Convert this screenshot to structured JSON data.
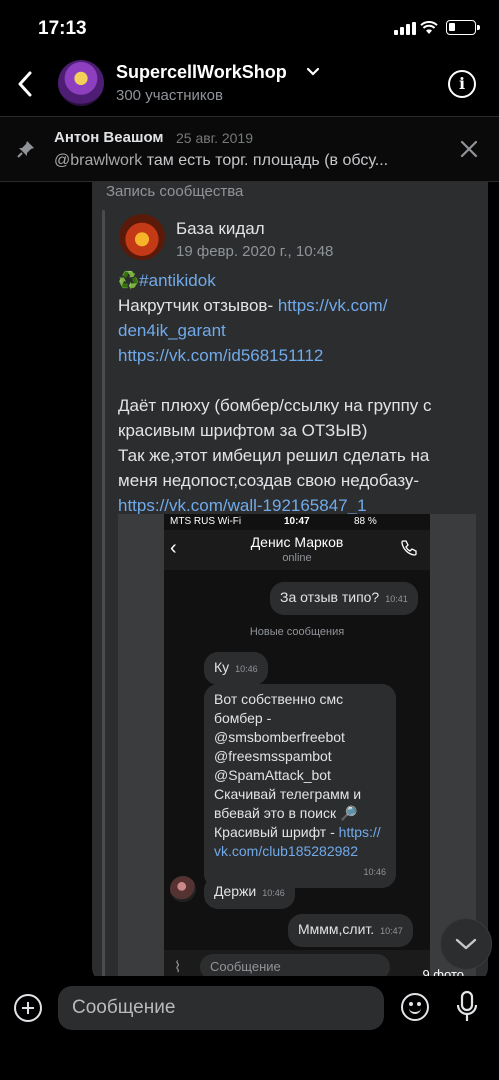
{
  "status_bar": {
    "time": "17:13"
  },
  "header": {
    "title": "SupercellWorkShop",
    "subtitle": "300 участников"
  },
  "pinned": {
    "author": "Антон Веашом",
    "date": "25 авг. 2019",
    "mention": "@brawlwork",
    "text": " там есть торг. площадь (в обсу..."
  },
  "post": {
    "label": "Запись сообщества",
    "group_name": "База кидал",
    "date": "19 февр. 2020 г., 10:48",
    "hashtag": "♻️#antikidok",
    "line1_text": "Накрутчик отзывов- ",
    "line1_link": "https://vk.com/",
    "line2_link": "den4ik_garant",
    "line3_link": "https://vk.com/id568151112",
    "line4": "Даёт плюху (бомбер/ссылку на группу с",
    "line5": "красивым шрифтом за ОТЗЫВ)",
    "line6": "Так же,этот имбецил решил сделать на",
    "line7": "меня недопост,создав свою недобазу-",
    "line8_link": "https://vk.com/wall-192165847_1"
  },
  "screenshot": {
    "carrier": "MTS RUS Wi-Fi",
    "time": "10:47",
    "battery": "88 %",
    "contact": "Денис Марков",
    "contact_status": "online",
    "msg1": "За отзыв типо?",
    "msg1_time": "10:41",
    "new_messages": "Новые сообщения",
    "msg2": "Ку",
    "msg2_time": "10:46",
    "msg3_lines": [
      "Вот собственно смс",
      "бомбер -",
      "@smsbomberfreebot",
      "@freesmsspambot",
      "@SpamAttack_bot",
      "Скачивай телеграмм и",
      "вбевай это в поиск 🔎",
      "Красивый шрифт - "
    ],
    "msg3_link1": "https://",
    "msg3_link2": "vk.com/club185282982",
    "msg3_time": "10:46",
    "msg4": "Держи",
    "msg4_time": "10:46",
    "msg5": "Мммм,слит.",
    "msg5_time": "10:47",
    "input_placeholder": "Сообщение"
  },
  "photo_count": "9 фото",
  "composer": {
    "placeholder": "Сообщение"
  }
}
